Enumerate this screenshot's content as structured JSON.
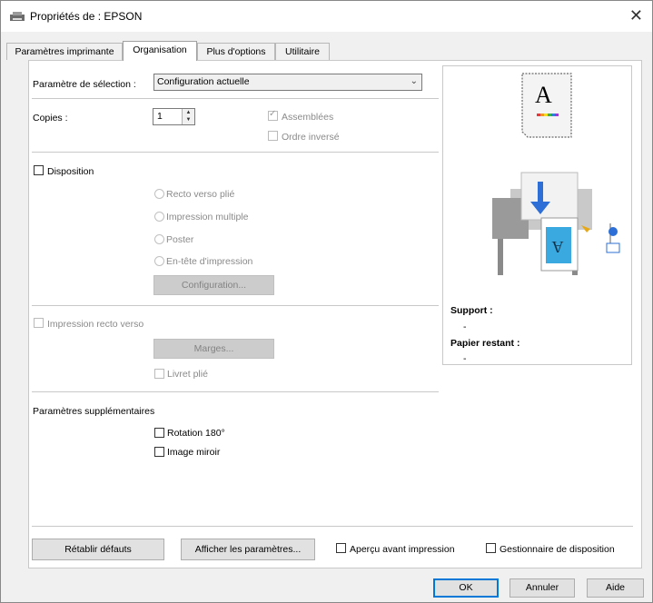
{
  "window": {
    "title": "Propriétés de : EPSON",
    "close_glyph": "✕"
  },
  "tabs": [
    {
      "label": "Paramètres imprimante",
      "active": false
    },
    {
      "label": "Organisation",
      "active": true
    },
    {
      "label": "Plus d'options",
      "active": false
    },
    {
      "label": "Utilitaire",
      "active": false
    }
  ],
  "selection": {
    "label": "Paramètre de sélection :",
    "value": "Configuration actuelle",
    "arrow": "⌄"
  },
  "copies": {
    "label": "Copies :",
    "value": "1",
    "collate_label": "Assemblées",
    "collate_checked": true,
    "reverse_label": "Ordre inversé",
    "reverse_checked": false
  },
  "layout": {
    "label": "Disposition",
    "checked": false,
    "options": [
      "Recto verso plié",
      "Impression multiple",
      "Poster",
      "En-tête d'impression"
    ],
    "config_button": "Configuration..."
  },
  "duplex": {
    "label": "Impression recto verso",
    "margins_button": "Marges...",
    "booklet_label": "Livret plié"
  },
  "additional": {
    "label": "Paramètres supplémentaires",
    "rotate_label": "Rotation 180°",
    "mirror_label": "Image miroir"
  },
  "preview": {
    "page_letter": "A",
    "support_label": "Support :",
    "support_value": "-",
    "paper_label": "Papier restant :",
    "paper_value": "-"
  },
  "bottom": {
    "restore_button": "Rétablir défauts",
    "show_settings_button": "Afficher les paramètres...",
    "preview_label": "Aperçu avant impression",
    "layout_manager_label": "Gestionnaire de disposition"
  },
  "footer": {
    "ok": "OK",
    "cancel": "Annuler",
    "help": "Aide"
  },
  "colors": {
    "accent": "#0078d7",
    "disabled_text": "#8a8a8a",
    "printer_arrow": "#2d6fd6",
    "sheet_blue": "#3aa9e0"
  }
}
